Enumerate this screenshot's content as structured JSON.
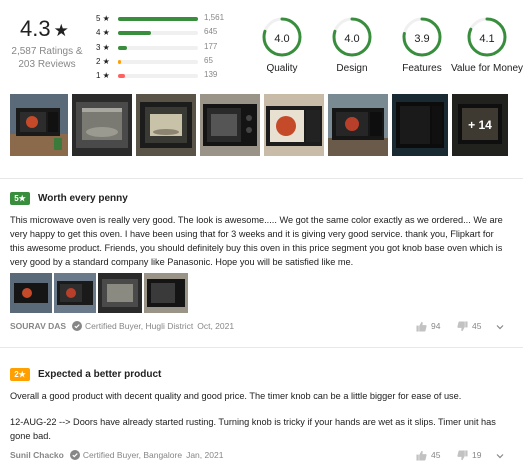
{
  "summary": {
    "overall_rating": "4.3",
    "star_glyph": "★",
    "ratings_count": "2,587 Ratings &",
    "reviews_count": "203 Reviews",
    "breakdown": [
      {
        "label": "5 ★",
        "count": "1,561",
        "fraction": 1.0,
        "color": "#388e3c"
      },
      {
        "label": "4 ★",
        "count": "645",
        "fraction": 0.413,
        "color": "#388e3c"
      },
      {
        "label": "3 ★",
        "count": "177",
        "fraction": 0.113,
        "color": "#388e3c"
      },
      {
        "label": "2 ★",
        "count": "65",
        "fraction": 0.042,
        "color": "#ff9f00"
      },
      {
        "label": "1 ★",
        "count": "139",
        "fraction": 0.089,
        "color": "#ff6161"
      }
    ],
    "features": [
      {
        "value": "4.0",
        "name": "Quality",
        "fraction": 0.8
      },
      {
        "value": "4.0",
        "name": "Design",
        "fraction": 0.8
      },
      {
        "value": "3.9",
        "name": "Features",
        "fraction": 0.78
      },
      {
        "value": "4.1",
        "name": "Value for Money",
        "fraction": 0.82
      }
    ]
  },
  "photos": {
    "more_label": "+ 14"
  },
  "reviews": [
    {
      "rating": "5",
      "badge_color": "#388e3c",
      "title": "Worth every penny",
      "body": "This microwave oven is really very good. The look is awesome..... We got the same color exactly as we ordered... We are very happy to get this oven. I have been using that for 3 weeks and it is giving very good service. thank you, Flipkart for this awesome product. Friends, you should definitely buy this oven in this price segment you got knob base oven which is very good by a standard company like Panasonic. Hope you will be satisfied like me.",
      "author": "SOURAV DAS",
      "certified": "Certified Buyer, Hugli District",
      "date": "Oct, 2021",
      "likes": "94",
      "dislikes": "45"
    },
    {
      "rating": "2",
      "badge_color": "#ff9f00",
      "title": "Expected a better product",
      "body_1": "Overall a good product with decent quality and good price. The timer knob can be a little bigger for ease of use.",
      "body_2": "12-AUG-22 --> Doors have already started rusting. Turning knob is tricky if your hands are wet as it slips. Timer unit has gone bad.",
      "author": "Sunil Chacko",
      "certified": "Certified Buyer, Bangalore",
      "date": "Jan, 2021",
      "likes": "45",
      "dislikes": "19"
    }
  ],
  "colors": {
    "gauge_green": "#388e3c",
    "gauge_track": "#f0f0f0",
    "muted_text": "#878787"
  }
}
